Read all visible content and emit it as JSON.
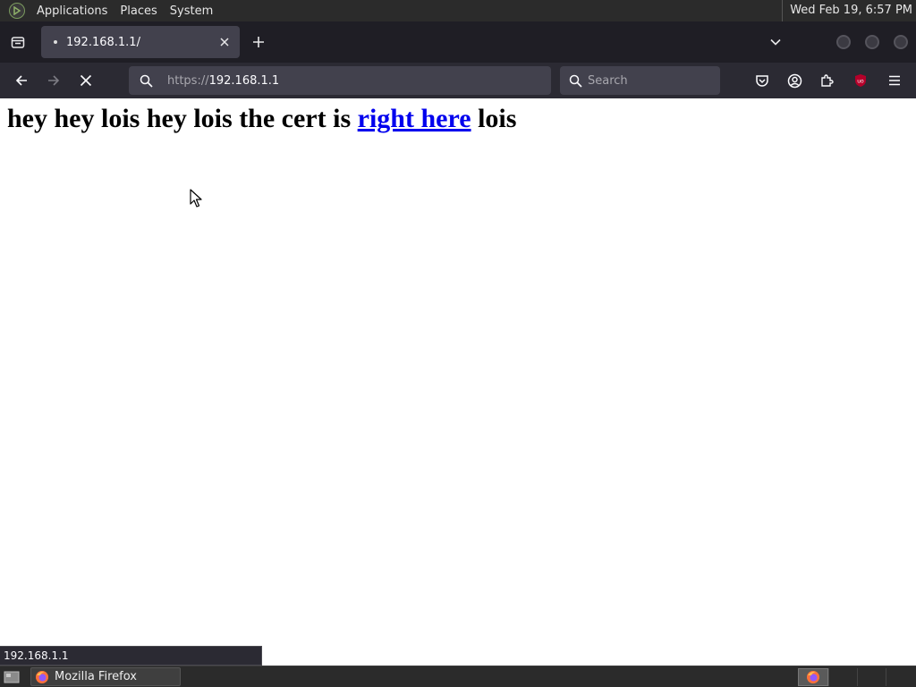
{
  "top_panel": {
    "menus": [
      "Applications",
      "Places",
      "System"
    ],
    "clock": "Wed Feb 19,  6:57 PM"
  },
  "tab": {
    "title": "192.168.1.1/"
  },
  "nav": {
    "url_scheme": "https://",
    "url_host": "192.168.1.1",
    "search_placeholder": "Search"
  },
  "page": {
    "heading_before": "hey hey lois hey lois the cert is ",
    "link_text": "right here",
    "heading_after": " lois"
  },
  "status_text": "192.168.1.1",
  "taskbar": {
    "window_title": "Mozilla Firefox"
  },
  "colors": {
    "link": "#0000ee",
    "toolbar": "#2b2a33",
    "tab_strip": "#1f1e25",
    "ublock_red": "#b5002a"
  }
}
